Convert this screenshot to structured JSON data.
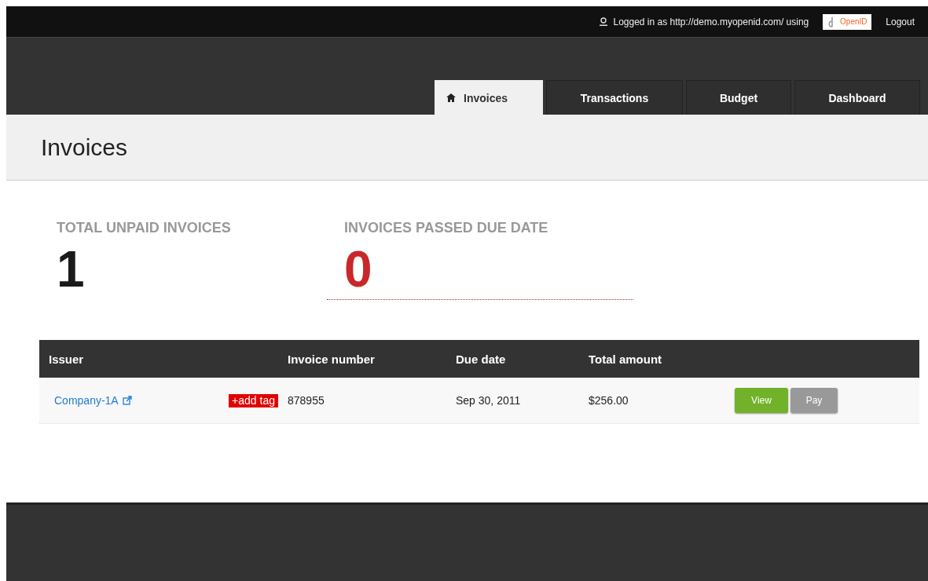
{
  "top_bar": {
    "login_text": "Logged in as http://demo.myopenid.com/ using",
    "provider_logo": "OpenID",
    "logout": "Logout"
  },
  "tabs": [
    {
      "label": "Invoices",
      "selected": true,
      "home": true
    },
    {
      "label": "Transactions",
      "selected": false,
      "home": false
    },
    {
      "label": "Budget",
      "selected": false,
      "home": false
    },
    {
      "label": "Dashboard",
      "selected": false,
      "home": false
    }
  ],
  "page_title": "Invoices",
  "stats": [
    {
      "label": "TOTAL UNPAID INVOICES",
      "value": "1",
      "alert": false
    },
    {
      "label": "INVOICES PASSED DUE DATE",
      "value": "0",
      "alert": true
    }
  ],
  "table": {
    "columns": [
      "Issuer",
      "Invoice number",
      "Due date",
      "Total amount"
    ],
    "rows": [
      {
        "issuer": "Company-1A",
        "tag": "+add tag",
        "invoice_number": "878955",
        "due_date": "Sep 30, 2011",
        "total": "$256.00",
        "actions": [
          {
            "label": "View",
            "kind": "primary"
          },
          {
            "label": "Pay",
            "kind": "secondary"
          }
        ]
      }
    ]
  }
}
